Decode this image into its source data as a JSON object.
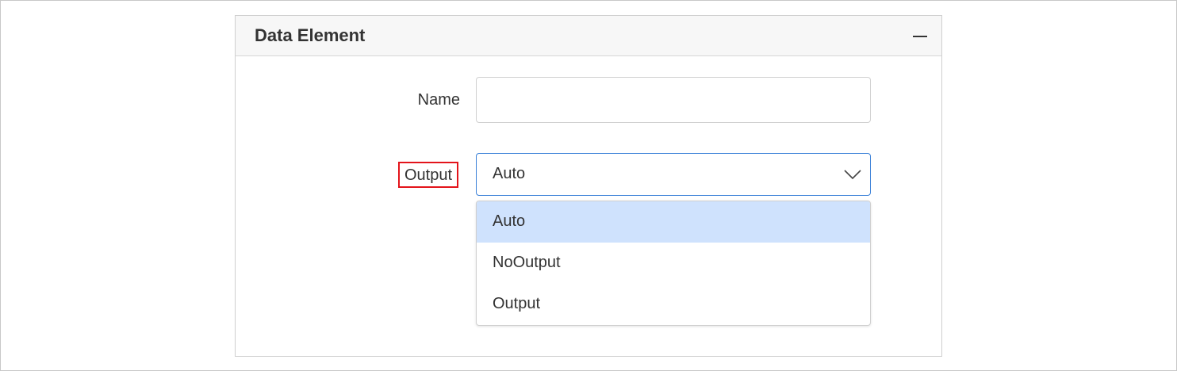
{
  "panel": {
    "title": "Data Element",
    "collapse_icon": "minus-icon"
  },
  "form": {
    "name_label": "Name",
    "name_value": "",
    "output_label": "Output",
    "output_selected": "Auto",
    "dropdown_icon": "chevron-down-icon"
  },
  "dropdown": {
    "options": [
      "Auto",
      "NoOutput",
      "Output"
    ],
    "selected_index": 0
  },
  "colors": {
    "highlight_border": "#e3141b",
    "focus_border": "#3a80d8",
    "selected_option_bg": "#cfe2fd"
  }
}
